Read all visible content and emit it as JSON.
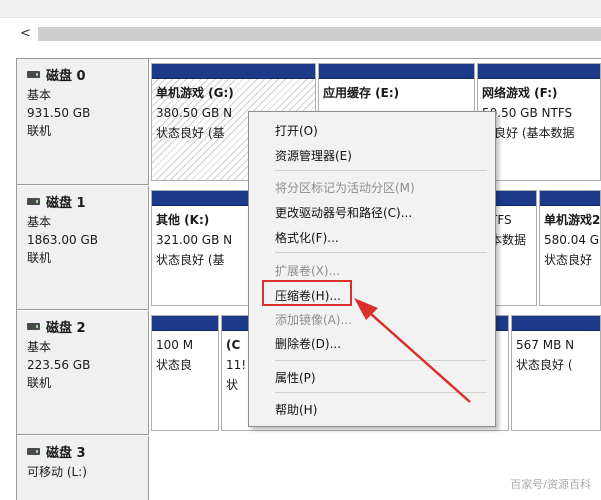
{
  "colors": {
    "partition_bar": "#1d3a8a",
    "annotation_red": "#d9302c"
  },
  "scrollbar": {
    "left_arrow": "<"
  },
  "disks": [
    {
      "name": "磁盘 0",
      "type": "基本",
      "size": "931.50 GB",
      "status": "联机"
    },
    {
      "name": "磁盘 1",
      "type": "基本",
      "size": "1863.00 GB",
      "status": "联机"
    },
    {
      "name": "磁盘 2",
      "type": "基本",
      "size": "223.56 GB",
      "status": "联机"
    },
    {
      "name": "磁盘 3",
      "type": "可移动 (L:)"
    }
  ],
  "disk0_partitions": [
    {
      "title": "单机游戏 (G:)",
      "line1": "380.50 GB N",
      "line2": "状态良好 (基"
    },
    {
      "title": "应用缓存 (E:)",
      "line1": "",
      "line2": ""
    },
    {
      "title": "网络游戏 (F:)",
      "line1": "50.50 GB NTFS",
      "line2": "态良好 (基本数据"
    }
  ],
  "disk1_partitions": [
    {
      "title": "其他 (K:)",
      "line1": "321.00 GB N",
      "line2": "状态良好 (基"
    },
    {
      "title": "",
      "line1": "TFS",
      "line2": "本数据"
    },
    {
      "title": "单机游戏2",
      "line1": "580.04 G",
      "line2": "状态良好"
    }
  ],
  "disk2_partitions": [
    {
      "title": "",
      "line1": "100 M",
      "line2": "状态良"
    },
    {
      "title": "(C",
      "line1": "11!",
      "line2": "状"
    },
    {
      "title": "",
      "line1": "567 MB N",
      "line2": "状态良好 ("
    }
  ],
  "context_menu": {
    "items": [
      {
        "label": "打开(O)",
        "enabled": true
      },
      {
        "label": "资源管理器(E)",
        "enabled": true
      },
      {
        "label": "将分区标记为活动分区(M)",
        "enabled": false
      },
      {
        "label": "更改驱动器号和路径(C)...",
        "enabled": true
      },
      {
        "label": "格式化(F)...",
        "enabled": true
      },
      {
        "label": "扩展卷(X)...",
        "enabled": false
      },
      {
        "label": "压缩卷(H)...",
        "enabled": true,
        "highlighted": true
      },
      {
        "label": "添加镜像(A)...",
        "enabled": false
      },
      {
        "label": "删除卷(D)...",
        "enabled": true
      },
      {
        "label": "属性(P)",
        "enabled": true
      },
      {
        "label": "帮助(H)",
        "enabled": true
      }
    ]
  },
  "watermark": "百家号/资源百科"
}
